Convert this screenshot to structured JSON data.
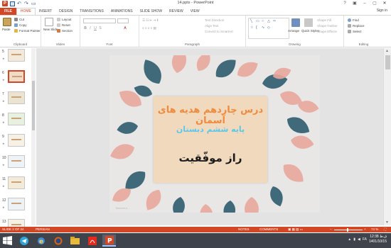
{
  "window": {
    "title": "14.pptx - PowerPoint",
    "logo": "P"
  },
  "tabs": {
    "file": "FILE",
    "items": [
      "HOME",
      "INSERT",
      "DESIGN",
      "TRANSITIONS",
      "ANIMATIONS",
      "SLIDE SHOW",
      "REVIEW",
      "VIEW"
    ],
    "active": "HOME",
    "sign_in": "Sign in"
  },
  "ribbon": {
    "clipboard": {
      "paste": "Paste",
      "cut": "Cut",
      "copy": "Copy",
      "format_painter": "Format Painter",
      "label": "Clipboard"
    },
    "slides": {
      "new_slide": "New Slide",
      "layout": "Layout",
      "reset": "Reset",
      "section": "Section",
      "label": "Slides"
    },
    "font": {
      "label": "Font",
      "bold": "B",
      "italic": "I",
      "underline": "U",
      "strike": "S",
      "font_color_glyph": "A"
    },
    "paragraph": {
      "text_direction": "Text Direction",
      "align_text": "Align Text",
      "convert": "Convert to SmartArt",
      "label": "Paragraph"
    },
    "drawing": {
      "arrange": "Arrange",
      "quick_styles": "Quick Styles",
      "shape_fill": "Shape Fill",
      "shape_outline": "Shape Outline",
      "shape_effects": "Shape Effects",
      "label": "Drawing"
    },
    "editing": {
      "find": "Find",
      "replace": "Replace",
      "select": "Select",
      "label": "Editing"
    }
  },
  "thumbnails": [
    {
      "num": "5",
      "selected": false
    },
    {
      "num": "6",
      "selected": true
    },
    {
      "num": "7",
      "selected": false
    },
    {
      "num": "8",
      "selected": false
    },
    {
      "num": "9",
      "selected": false
    },
    {
      "num": "10",
      "selected": false
    },
    {
      "num": "11",
      "selected": false
    },
    {
      "num": "12",
      "selected": false
    },
    {
      "num": "13",
      "selected": false
    }
  ],
  "slide": {
    "line1": "درس چاردهم هدیه های آسمان",
    "line2": "پایه ششم دبستان",
    "line3": "راز موفّقیت",
    "watermark": "Teacher.ir",
    "colors": {
      "background": "#e8e7e5",
      "card": "#f1d9be",
      "line1": "#f08a3c",
      "line2": "#5cc7e8",
      "line3": "#1a1a1a",
      "leaf_dark": "#2e5b6e",
      "leaf_pink": "#e8a79c"
    }
  },
  "status": {
    "slide_info": "SLIDE 2 OF 24",
    "language": "PERSIAN",
    "notes": "NOTES",
    "comments": "COMMENTS",
    "zoom": "74 %"
  },
  "taskbar": {
    "apps": [
      "telegram-icon",
      "ie-icon",
      "firefox-icon",
      "explorer-icon",
      "acrobat-icon",
      "powerpoint-icon"
    ],
    "active_app": "powerpoint-icon",
    "lang": "FA",
    "time": "12:38 ق.ظ",
    "date": "1401/10/15"
  }
}
